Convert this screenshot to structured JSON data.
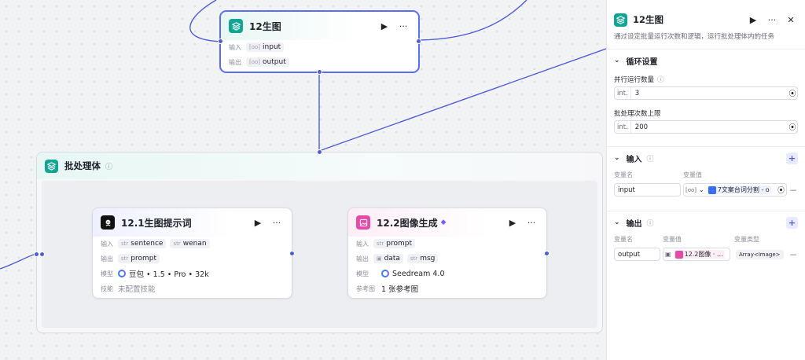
{
  "canvas": {
    "loop_node": {
      "title": "12生图",
      "input_label": "输入",
      "input_var": "input",
      "input_type": "[oo]",
      "output_label": "输出",
      "output_var": "output",
      "output_type": "[oo]"
    },
    "batch_group": {
      "title": "批处理体",
      "info_icon": "info-icon"
    },
    "prompt_node": {
      "title": "12.1生图提示词",
      "input_label": "输入",
      "inputs": [
        {
          "type": "str",
          "name": "sentence"
        },
        {
          "type": "str",
          "name": "wenan"
        }
      ],
      "output_label": "输出",
      "outputs": [
        {
          "type": "str",
          "name": "prompt"
        }
      ],
      "model_label": "模型",
      "model_value": "豆包 • 1.5 • Pro • 32k",
      "skill_label": "技能",
      "skill_value": "未配置技能"
    },
    "image_node": {
      "title": "12.2图像生成",
      "input_label": "输入",
      "inputs": [
        {
          "type": "str",
          "name": "prompt"
        }
      ],
      "output_label": "输出",
      "outputs": [
        {
          "type": "img",
          "name": "data"
        },
        {
          "type": "str",
          "name": "msg"
        }
      ],
      "model_label": "模型",
      "model_value": "Seedream 4.0",
      "ref_label": "参考图",
      "ref_value": "1 张参考图"
    }
  },
  "panel": {
    "title": "12生图",
    "description": "通过设定批量运行次数和逻辑，运行批处理体内的任务",
    "loop_section": {
      "title": "循环设置",
      "parallel_label": "并行运行数量",
      "parallel_unit": "int.",
      "parallel_value": "3",
      "limit_label": "批处理次数上限",
      "limit_unit": "int.",
      "limit_value": "200"
    },
    "input_section": {
      "title": "输入",
      "col_name": "变量名",
      "col_value": "变量值",
      "var_name": "input",
      "var_type": "[oo]",
      "var_value": "7文案台词分割 - o"
    },
    "output_section": {
      "title": "输出",
      "col_name": "变量名",
      "col_value": "变量值",
      "col_type": "变量类型",
      "var_name": "output",
      "var_value": "12.2图像 · ...",
      "var_type": "Array<Image>"
    }
  },
  "colors": {
    "accent": "#4d5cd8",
    "teal_icon": "#12a594",
    "pink_icon": "#e64aa8"
  }
}
